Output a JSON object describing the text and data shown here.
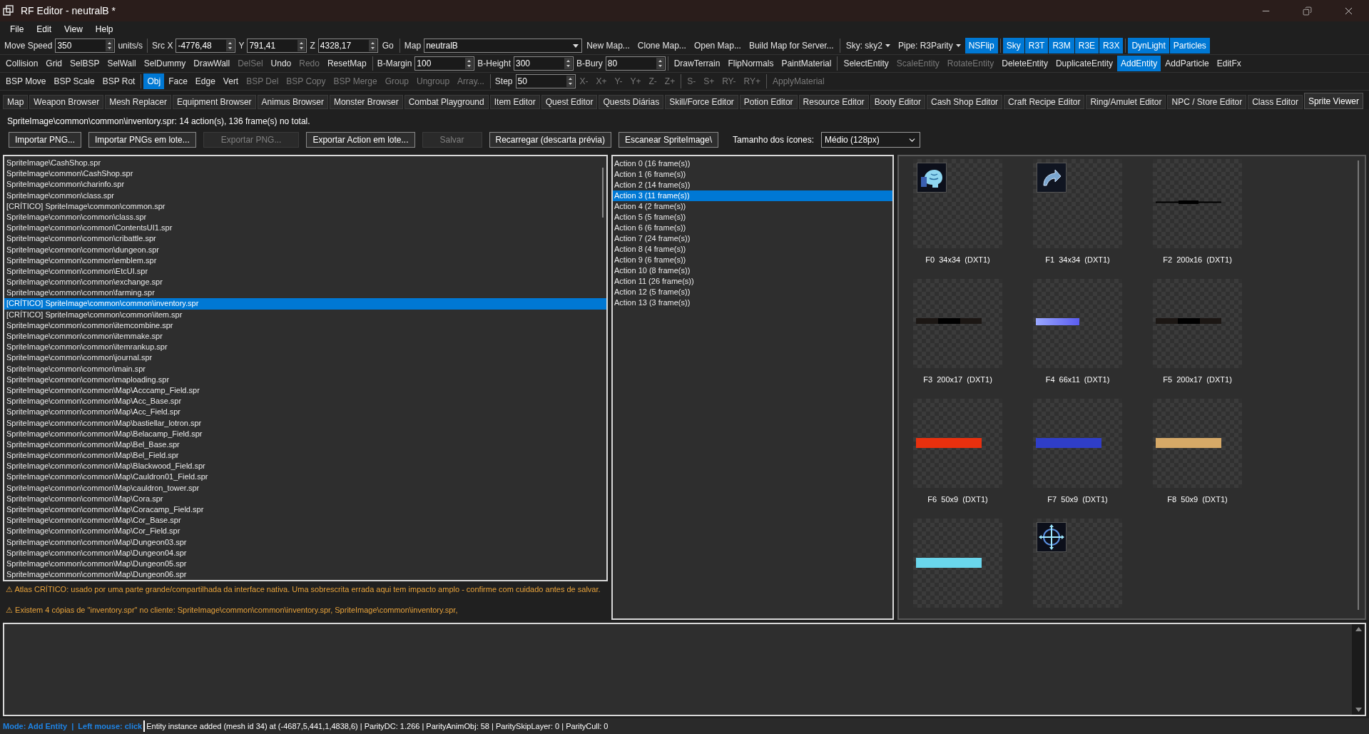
{
  "window": {
    "title": "RF Editor - neutralB *"
  },
  "menu": [
    "File",
    "Edit",
    "View",
    "Help"
  ],
  "toolbars": [
    [
      [
        {
          "kind": "label",
          "text": "Move Speed"
        },
        {
          "kind": "spin",
          "value": "350"
        },
        {
          "kind": "label",
          "text": "units/s"
        }
      ],
      [
        {
          "kind": "label",
          "text": "Src X"
        },
        {
          "kind": "spin",
          "value": "-4776,48"
        },
        {
          "kind": "label",
          "text": "Y"
        },
        {
          "kind": "spin",
          "value": "791,41"
        },
        {
          "kind": "label",
          "text": "Z"
        },
        {
          "kind": "spin",
          "value": "4328,17"
        },
        {
          "kind": "button",
          "text": "Go",
          "selected": false,
          "disabled": false
        }
      ],
      [
        {
          "kind": "label",
          "text": "Map"
        },
        {
          "kind": "combo",
          "value": "neutralB"
        },
        {
          "kind": "button",
          "text": "New Map...",
          "selected": false,
          "disabled": false
        },
        {
          "kind": "button",
          "text": "Clone Map...",
          "selected": false,
          "disabled": false
        },
        {
          "kind": "button",
          "text": "Open Map...",
          "selected": false,
          "disabled": false
        },
        {
          "kind": "button",
          "text": "Build Map for Server...",
          "selected": false,
          "disabled": false
        }
      ],
      [
        {
          "kind": "dropdown",
          "text": "Sky: sky2"
        },
        {
          "kind": "dropdown",
          "text": "Pipe: R3Parity"
        },
        {
          "kind": "button",
          "text": "NSFlip",
          "selected": true,
          "disabled": false
        }
      ],
      [
        {
          "kind": "button",
          "text": "Sky",
          "selected": true,
          "disabled": false
        },
        {
          "kind": "button",
          "text": "R3T",
          "selected": true,
          "disabled": false
        },
        {
          "kind": "button",
          "text": "R3M",
          "selected": true,
          "disabled": false
        },
        {
          "kind": "button",
          "text": "R3E",
          "selected": true,
          "disabled": false
        },
        {
          "kind": "button",
          "text": "R3X",
          "selected": true,
          "disabled": false
        }
      ],
      [
        {
          "kind": "button",
          "text": "DynLight",
          "selected": true,
          "disabled": false
        },
        {
          "kind": "button",
          "text": "Particles",
          "selected": true,
          "disabled": false
        }
      ]
    ],
    [
      [
        {
          "kind": "button",
          "text": "Collision",
          "selected": false,
          "disabled": false
        },
        {
          "kind": "button",
          "text": "Grid",
          "selected": false,
          "disabled": false
        },
        {
          "kind": "button",
          "text": "SelBSP",
          "selected": false,
          "disabled": false
        },
        {
          "kind": "button",
          "text": "SelWall",
          "selected": false,
          "disabled": false
        },
        {
          "kind": "button",
          "text": "SelDummy",
          "selected": false,
          "disabled": false
        },
        {
          "kind": "button",
          "text": "DrawWall",
          "selected": false,
          "disabled": false
        },
        {
          "kind": "button",
          "text": "DelSel",
          "selected": false,
          "disabled": true
        },
        {
          "kind": "button",
          "text": "Undo",
          "selected": false,
          "disabled": false
        },
        {
          "kind": "button",
          "text": "Redo",
          "selected": false,
          "disabled": true
        },
        {
          "kind": "button",
          "text": "ResetMap",
          "selected": false,
          "disabled": false
        }
      ],
      [
        {
          "kind": "label",
          "text": "B-Margin"
        },
        {
          "kind": "spin",
          "value": "100"
        },
        {
          "kind": "label",
          "text": "B-Height"
        },
        {
          "kind": "spin",
          "value": "300"
        },
        {
          "kind": "label",
          "text": "B-Bury"
        },
        {
          "kind": "spin",
          "value": "80"
        }
      ],
      [
        {
          "kind": "button",
          "text": "DrawTerrain",
          "selected": false,
          "disabled": false
        },
        {
          "kind": "button",
          "text": "FlipNormals",
          "selected": false,
          "disabled": false
        },
        {
          "kind": "button",
          "text": "PaintMaterial",
          "selected": false,
          "disabled": false
        }
      ],
      [
        {
          "kind": "button",
          "text": "SelectEntity",
          "selected": false,
          "disabled": false
        },
        {
          "kind": "button",
          "text": "ScaleEntity",
          "selected": false,
          "disabled": true
        },
        {
          "kind": "button",
          "text": "RotateEntity",
          "selected": false,
          "disabled": true
        },
        {
          "kind": "button",
          "text": "DeleteEntity",
          "selected": false,
          "disabled": false
        },
        {
          "kind": "button",
          "text": "DuplicateEntity",
          "selected": false,
          "disabled": false
        },
        {
          "kind": "button",
          "text": "AddEntity",
          "selected": true,
          "disabled": false
        },
        {
          "kind": "button",
          "text": "AddParticle",
          "selected": false,
          "disabled": false
        },
        {
          "kind": "button",
          "text": "EditFx",
          "selected": false,
          "disabled": false
        }
      ]
    ],
    [
      [
        {
          "kind": "button",
          "text": "BSP Move",
          "selected": false,
          "disabled": false
        },
        {
          "kind": "button",
          "text": "BSP Scale",
          "selected": false,
          "disabled": false
        },
        {
          "kind": "button",
          "text": "BSP Rot",
          "selected": false,
          "disabled": false
        }
      ],
      [
        {
          "kind": "button",
          "text": "Obj",
          "selected": true,
          "disabled": false
        },
        {
          "kind": "button",
          "text": "Face",
          "selected": false,
          "disabled": false
        },
        {
          "kind": "button",
          "text": "Edge",
          "selected": false,
          "disabled": false
        },
        {
          "kind": "button",
          "text": "Vert",
          "selected": false,
          "disabled": false
        },
        {
          "kind": "button",
          "text": "BSP Del",
          "selected": false,
          "disabled": true
        },
        {
          "kind": "button",
          "text": "BSP Copy",
          "selected": false,
          "disabled": true
        },
        {
          "kind": "button",
          "text": "BSP Merge",
          "selected": false,
          "disabled": true
        },
        {
          "kind": "button",
          "text": "Group",
          "selected": false,
          "disabled": true
        },
        {
          "kind": "button",
          "text": "Ungroup",
          "selected": false,
          "disabled": true
        },
        {
          "kind": "button",
          "text": "Array...",
          "selected": false,
          "disabled": true
        }
      ],
      [
        {
          "kind": "label",
          "text": "Step"
        },
        {
          "kind": "spin",
          "value": "50"
        },
        {
          "kind": "button",
          "text": "X-",
          "selected": false,
          "disabled": true
        },
        {
          "kind": "button",
          "text": "X+",
          "selected": false,
          "disabled": true
        },
        {
          "kind": "button",
          "text": "Y-",
          "selected": false,
          "disabled": true
        },
        {
          "kind": "button",
          "text": "Y+",
          "selected": false,
          "disabled": true
        },
        {
          "kind": "button",
          "text": "Z-",
          "selected": false,
          "disabled": true
        },
        {
          "kind": "button",
          "text": "Z+",
          "selected": false,
          "disabled": true
        }
      ],
      [
        {
          "kind": "button",
          "text": "S-",
          "selected": false,
          "disabled": true
        },
        {
          "kind": "button",
          "text": "S+",
          "selected": false,
          "disabled": true
        },
        {
          "kind": "button",
          "text": "RY-",
          "selected": false,
          "disabled": true
        },
        {
          "kind": "button",
          "text": "RY+",
          "selected": false,
          "disabled": true
        }
      ],
      [
        {
          "kind": "button",
          "text": "ApplyMaterial",
          "selected": false,
          "disabled": true
        }
      ]
    ]
  ],
  "tabs": [
    {
      "label": "Map",
      "selected": false
    },
    {
      "label": "Weapon Browser",
      "selected": false
    },
    {
      "label": "Mesh Replacer",
      "selected": false
    },
    {
      "label": "Equipment Browser",
      "selected": false
    },
    {
      "label": "Animus Browser",
      "selected": false
    },
    {
      "label": "Monster Browser",
      "selected": false
    },
    {
      "label": "Combat Playground",
      "selected": false
    },
    {
      "label": "Item Editor",
      "selected": false
    },
    {
      "label": "Quest Editor",
      "selected": false
    },
    {
      "label": "Quests Diárias",
      "selected": false
    },
    {
      "label": "Skill/Force Editor",
      "selected": false
    },
    {
      "label": "Potion Editor",
      "selected": false
    },
    {
      "label": "Resource Editor",
      "selected": false
    },
    {
      "label": "Booty Editor",
      "selected": false
    },
    {
      "label": "Cash Shop Editor",
      "selected": false
    },
    {
      "label": "Craft Recipe Editor",
      "selected": false
    },
    {
      "label": "Ring/Amulet Editor",
      "selected": false
    },
    {
      "label": "NPC / Store Editor",
      "selected": false
    },
    {
      "label": "Class Editor",
      "selected": false
    },
    {
      "label": "Sprite Viewer",
      "selected": true
    }
  ],
  "summary": "SpriteImage\\common\\common\\inventory.spr: 14 action(s), 136 frame(s) no total.",
  "actions_bar": {
    "buttons": [
      {
        "label": "Importar PNG...",
        "disabled": false
      },
      {
        "label": "Importar PNGs em lote...",
        "disabled": false
      },
      {
        "label": "Exportar PNG...",
        "disabled": true
      },
      {
        "label": "Exportar Action em lote...",
        "disabled": false
      },
      {
        "label": "Salvar",
        "disabled": true
      },
      {
        "label": "Recarregar (descarta prévia)",
        "disabled": false
      },
      {
        "label": "Escanear SpriteImage\\",
        "disabled": false
      }
    ],
    "icon_size_label": "Tamanho dos ícones:",
    "icon_size": "Médio (128px)"
  },
  "files": [
    {
      "text": "SpriteImage\\CashShop.spr",
      "selected": false
    },
    {
      "text": "SpriteImage\\common\\CashShop.spr",
      "selected": false
    },
    {
      "text": "SpriteImage\\common\\charinfo.spr",
      "selected": false
    },
    {
      "text": "SpriteImage\\common\\class.spr",
      "selected": false
    },
    {
      "text": "[CRÍTICO] SpriteImage\\common\\common.spr",
      "selected": false
    },
    {
      "text": "SpriteImage\\common\\common\\class.spr",
      "selected": false
    },
    {
      "text": "SpriteImage\\common\\common\\ContentsUI1.spr",
      "selected": false
    },
    {
      "text": "SpriteImage\\common\\common\\cribattle.spr",
      "selected": false
    },
    {
      "text": "SpriteImage\\common\\common\\dungeon.spr",
      "selected": false
    },
    {
      "text": "SpriteImage\\common\\common\\emblem.spr",
      "selected": false
    },
    {
      "text": "SpriteImage\\common\\common\\EtcUI.spr",
      "selected": false
    },
    {
      "text": "SpriteImage\\common\\common\\exchange.spr",
      "selected": false
    },
    {
      "text": "SpriteImage\\common\\common\\farming.spr",
      "selected": false
    },
    {
      "text": "[CRÍTICO] SpriteImage\\common\\common\\inventory.spr",
      "selected": true
    },
    {
      "text": "[CRÍTICO] SpriteImage\\common\\common\\item.spr",
      "selected": false
    },
    {
      "text": "SpriteImage\\common\\common\\itemcombine.spr",
      "selected": false
    },
    {
      "text": "SpriteImage\\common\\common\\itemmake.spr",
      "selected": false
    },
    {
      "text": "SpriteImage\\common\\common\\itemrankup.spr",
      "selected": false
    },
    {
      "text": "SpriteImage\\common\\common\\journal.spr",
      "selected": false
    },
    {
      "text": "SpriteImage\\common\\common\\main.spr",
      "selected": false
    },
    {
      "text": "SpriteImage\\common\\common\\maploading.spr",
      "selected": false
    },
    {
      "text": "SpriteImage\\common\\common\\Map\\Acccamp_Field.spr",
      "selected": false
    },
    {
      "text": "SpriteImage\\common\\common\\Map\\Acc_Base.spr",
      "selected": false
    },
    {
      "text": "SpriteImage\\common\\common\\Map\\Acc_Field.spr",
      "selected": false
    },
    {
      "text": "SpriteImage\\common\\common\\Map\\bastiellar_lotron.spr",
      "selected": false
    },
    {
      "text": "SpriteImage\\common\\common\\Map\\Belacamp_Field.spr",
      "selected": false
    },
    {
      "text": "SpriteImage\\common\\common\\Map\\Bel_Base.spr",
      "selected": false
    },
    {
      "text": "SpriteImage\\common\\common\\Map\\Bel_Field.spr",
      "selected": false
    },
    {
      "text": "SpriteImage\\common\\common\\Map\\Blackwood_Field.spr",
      "selected": false
    },
    {
      "text": "SpriteImage\\common\\common\\Map\\Cauldron01_Field.spr",
      "selected": false
    },
    {
      "text": "SpriteImage\\common\\common\\Map\\cauldron_tower.spr",
      "selected": false
    },
    {
      "text": "SpriteImage\\common\\common\\Map\\Cora.spr",
      "selected": false
    },
    {
      "text": "SpriteImage\\common\\common\\Map\\Coracamp_Field.spr",
      "selected": false
    },
    {
      "text": "SpriteImage\\common\\common\\Map\\Cor_Base.spr",
      "selected": false
    },
    {
      "text": "SpriteImage\\common\\common\\Map\\Cor_Field.spr",
      "selected": false
    },
    {
      "text": "SpriteImage\\common\\common\\Map\\Dungeon03.spr",
      "selected": false
    },
    {
      "text": "SpriteImage\\common\\common\\Map\\Dungeon04.spr",
      "selected": false
    },
    {
      "text": "SpriteImage\\common\\common\\Map\\Dungeon05.spr",
      "selected": false
    },
    {
      "text": "SpriteImage\\common\\common\\Map\\Dungeon06.spr",
      "selected": false
    }
  ],
  "warnings": [
    "⚠ Atlas CRÍTICO: usado por uma parte grande/compartilhada da interface nativa. Uma sobrescrita errada aqui tem impacto amplo - confirme com cuidado antes de salvar.",
    "⚠ Existem 4 cópias de \"inventory.spr\" no cliente: SpriteImage\\common\\common\\inventory.spr, SpriteImage\\common\\inventory.spr,"
  ],
  "sprite_actions": [
    {
      "text": "Action 0 (16 frame(s))",
      "selected": false
    },
    {
      "text": "Action 1 (6 frame(s))",
      "selected": false
    },
    {
      "text": "Action 2 (14 frame(s))",
      "selected": false
    },
    {
      "text": "Action 3 (11 frame(s))",
      "selected": true
    },
    {
      "text": "Action 4 (2 frame(s))",
      "selected": false
    },
    {
      "text": "Action 5 (5 frame(s))",
      "selected": false
    },
    {
      "text": "Action 6 (6 frame(s))",
      "selected": false
    },
    {
      "text": "Action 7 (24 frame(s))",
      "selected": false
    },
    {
      "text": "Action 8 (4 frame(s))",
      "selected": false
    },
    {
      "text": "Action 9 (6 frame(s))",
      "selected": false
    },
    {
      "text": "Action 10 (8 frame(s))",
      "selected": false
    },
    {
      "text": "Action 11 (26 frame(s))",
      "selected": false
    },
    {
      "text": "Action 12 (5 frame(s))",
      "selected": false
    },
    {
      "text": "Action 13 (3 frame(s))",
      "selected": false
    }
  ],
  "frames": [
    {
      "kind": "head",
      "label": "F0  34x34  (DXT1)"
    },
    {
      "kind": "arrow",
      "label": "F1  34x34  (DXT1)"
    },
    {
      "kind": "line",
      "label": "F2  200x16  (DXT1)"
    },
    {
      "kind": "strip",
      "label": "F3  200x17  (DXT1)"
    },
    {
      "kind": "gradient",
      "label": "F4  66x11  (DXT1)",
      "color": "#5a5cf0"
    },
    {
      "kind": "strip",
      "label": "F5  200x17  (DXT1)"
    },
    {
      "kind": "bar",
      "label": "F6  50x9  (DXT1)",
      "color": "#e8300e"
    },
    {
      "kind": "bar",
      "label": "F7  50x9  (DXT1)",
      "color": "#2f3ec8"
    },
    {
      "kind": "bar",
      "label": "F8  50x9  (DXT1)",
      "color": "#d6a967"
    },
    {
      "kind": "bar",
      "color": "#6ad6ec"
    },
    {
      "kind": "crosshair"
    }
  ],
  "status_bar": {
    "mode": "Mode: Add Entity  |  Left mouse: click",
    "message": "Entity instance added (mesh id 34) at (-4687,5,441,1,4838,6) | ParityDC: 1.266 | ParityAnimObj: 58 | ParitySkipLayer: 0 | ParityCull: 0"
  }
}
